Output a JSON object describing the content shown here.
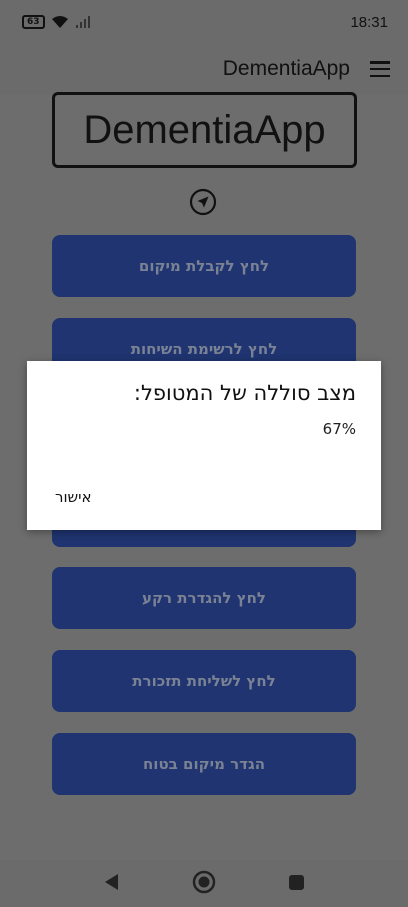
{
  "status_bar": {
    "time": "18:31",
    "battery": "63"
  },
  "app_bar": {
    "title": "DementiaApp"
  },
  "logo": {
    "text": "DementiaApp"
  },
  "buttons": [
    {
      "label": "לחץ לקבלת מיקום"
    },
    {
      "label": "לחץ לרשימת השיחות"
    },
    {
      "label": ""
    },
    {
      "label": "לחץ להגדרת רקע"
    },
    {
      "label": "לחץ לשליחת תזכורת"
    },
    {
      "label": "הגדר מיקום בטוח"
    }
  ],
  "dialog": {
    "title": "מצב סוללה של המטופל:",
    "message": "67%",
    "ok_label": "אישור"
  }
}
